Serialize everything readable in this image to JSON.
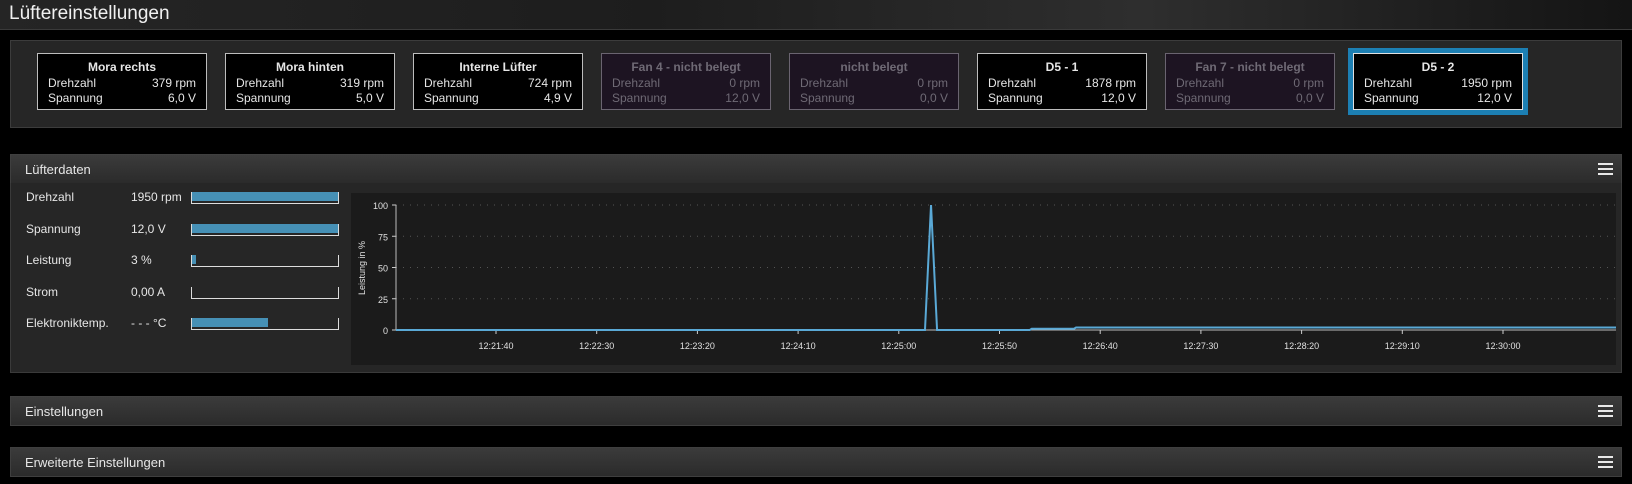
{
  "window": {
    "title": "Lüftereinstellungen"
  },
  "fans": [
    {
      "name": "Mora rechts",
      "rpm_label": "Drehzahl",
      "rpm": "379 rpm",
      "volt_label": "Spannung",
      "volt": "6,0 V",
      "state": "active"
    },
    {
      "name": "Mora hinten",
      "rpm_label": "Drehzahl",
      "rpm": "319 rpm",
      "volt_label": "Spannung",
      "volt": "5,0 V",
      "state": "active"
    },
    {
      "name": "Interne Lüfter",
      "rpm_label": "Drehzahl",
      "rpm": "724 rpm",
      "volt_label": "Spannung",
      "volt": "4,9 V",
      "state": "active"
    },
    {
      "name": "Fan 4 - nicht belegt",
      "rpm_label": "Drehzahl",
      "rpm": "0 rpm",
      "volt_label": "Spannung",
      "volt": "12,0 V",
      "state": "inactive"
    },
    {
      "name": "nicht belegt",
      "rpm_label": "Drehzahl",
      "rpm": "0 rpm",
      "volt_label": "Spannung",
      "volt": "0,0 V",
      "state": "inactive"
    },
    {
      "name": "D5 - 1",
      "rpm_label": "Drehzahl",
      "rpm": "1878 rpm",
      "volt_label": "Spannung",
      "volt": "12,0 V",
      "state": "active"
    },
    {
      "name": "Fan 7 - nicht belegt",
      "rpm_label": "Drehzahl",
      "rpm": "0 rpm",
      "volt_label": "Spannung",
      "volt": "0,0 V",
      "state": "inactive"
    },
    {
      "name": "D5 - 2",
      "rpm_label": "Drehzahl",
      "rpm": "1950 rpm",
      "volt_label": "Spannung",
      "volt": "12,0 V",
      "state": "selected"
    }
  ],
  "fan_data": {
    "title": "Lüfterdaten",
    "metrics": [
      {
        "label": "Drehzahl",
        "value": "1950 rpm",
        "fill": 1.0
      },
      {
        "label": "Spannung",
        "value": "12,0 V",
        "fill": 1.0
      },
      {
        "label": "Leistung",
        "value": "3 %",
        "fill": 0.03
      },
      {
        "label": "Strom",
        "value": "0,00 A",
        "fill": 0.0
      },
      {
        "label": "Elektroniktemp.",
        "value": "- - - °C",
        "fill": 0.52
      }
    ]
  },
  "chart_data": {
    "type": "line",
    "ylabel": "Leistung in %",
    "ylim": [
      0,
      100
    ],
    "yticks": [
      "0",
      "25",
      "50",
      "75",
      "100"
    ],
    "xticks": [
      "12:21:40",
      "12:22:30",
      "12:23:20",
      "12:24:10",
      "12:25:00",
      "12:25:50",
      "12:26:40",
      "12:27:30",
      "12:28:20",
      "12:29:10",
      "12:30:00"
    ],
    "series": [
      {
        "color": "#5aa9d6",
        "points": [
          [
            "12:20:42",
            0
          ],
          [
            "12:25:13",
            0
          ],
          [
            "12:25:16",
            100
          ],
          [
            "12:25:19",
            0
          ],
          [
            "12:26:05",
            0
          ],
          [
            "12:26:06",
            1
          ],
          [
            "12:26:27",
            1
          ],
          [
            "12:26:28",
            2
          ],
          [
            "12:31:25",
            2
          ]
        ]
      }
    ]
  },
  "sections": {
    "settings": "Einstellungen",
    "advanced": "Erweiterte Einstellungen"
  },
  "colors": {
    "accent": "#1c7fb3",
    "bar": "#4690b5",
    "line": "#5aa9d6"
  }
}
